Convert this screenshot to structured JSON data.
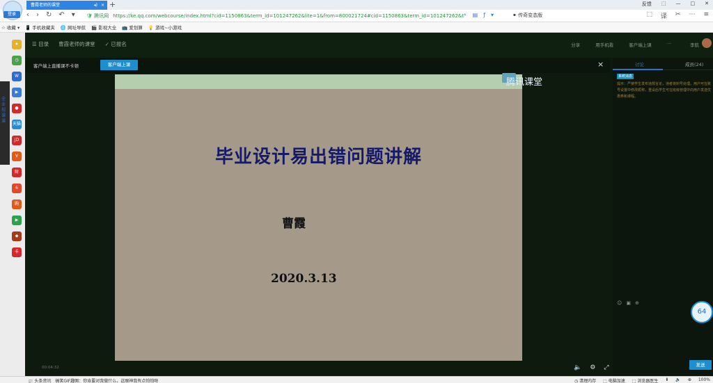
{
  "browser": {
    "login_label": "登录",
    "tab_title": "曹霞老师的课堂",
    "tab_sound_glyph": "◂)",
    "tab_close_glyph": "×",
    "new_tab_glyph": "+",
    "window_controls": [
      "反馈",
      "⬚",
      "—",
      "□",
      "✕"
    ]
  },
  "address_bar": {
    "nav": [
      "‹",
      "›",
      "↻",
      "↶",
      "▾"
    ],
    "secure_label": "🛡 腾讯网",
    "url": "https://ke.qq.com/webcourse/index.html?cid=1150863&term_id=101247262&lite=1&from=800021724#cid=1150863&term_id=101247262&t",
    "url_icons": [
      "⚡",
      "▤",
      "ƒ",
      "▾"
    ],
    "compat_mode": "⚫ 传奇变态版",
    "right_icons": [
      "⬚",
      "译",
      "✂",
      "⋯",
      "≡"
    ]
  },
  "bookmarks": [
    "☆ 收藏 ▾",
    "📱 手机收藏夹",
    "🌐 网址导航",
    "🎬 影视大全",
    "📺 爱划算",
    "💡 游戏~小游戏"
  ],
  "sidebar": {
    "vertical_label": "全业视课课",
    "icons": [
      {
        "name": "star",
        "label": "★",
        "color": "#e5b02a"
      },
      {
        "name": "clock",
        "label": "◷",
        "color": "#4aa14a"
      },
      {
        "name": "word",
        "label": "W",
        "color": "#2f6bd3"
      },
      {
        "name": "video",
        "label": "▶",
        "color": "#3a7bd5"
      },
      {
        "name": "record",
        "label": "●",
        "color": "#d22a2a"
      },
      {
        "name": "tmall",
        "label": "天猫",
        "color": "#2a8ad3"
      },
      {
        "name": "jd",
        "label": "JD",
        "color": "#d22a2a"
      },
      {
        "name": "vip",
        "label": "V",
        "color": "#e05a1a"
      },
      {
        "name": "finance",
        "label": "财",
        "color": "#d22a2a"
      },
      {
        "name": "weibo",
        "label": "6",
        "color": "#e04a2a"
      },
      {
        "name": "shopping",
        "label": "购",
        "color": "#e05a1a"
      },
      {
        "name": "play",
        "label": "▶",
        "color": "#2aa34a"
      },
      {
        "name": "game",
        "label": "◆",
        "color": "#a53a1a"
      },
      {
        "name": "card",
        "label": "卡",
        "color": "#d22a2a"
      }
    ]
  },
  "course": {
    "breadcrumb": [
      "☰ 目录",
      "曹霞老师的课堂",
      "✓ 已报名"
    ],
    "top_links": [
      "分享",
      "用手机看",
      "客户端上课",
      "···"
    ],
    "user_name": "李航",
    "notice_text": "客户端上直播课不卡顿",
    "notice_button": "客户端上课",
    "notice_close": "×"
  },
  "slide": {
    "logo_text": "腾讯课堂",
    "title": "毕业设计易出错问题讲解",
    "author": "曹霞",
    "date": "2020.3.13"
  },
  "chat": {
    "tab_discuss": "讨论",
    "tab_members": "成员(24)",
    "system_badge": "系统消息",
    "system_message": "提示：严禁学生发布违规言论，违者将封号处理。用户可在账号设置中修改昵称，重设后学生可在班级管理中向用户发送优惠券和课程。",
    "tools": [
      "☺",
      "▣",
      "⊕"
    ],
    "send_button": "发送",
    "speed_value": "64"
  },
  "video": {
    "time": "00:04:32",
    "controls": [
      "🔈",
      "⚙",
      "⤢"
    ]
  },
  "status_bar": {
    "left": [
      "📰 头条资讯",
      "搞笑GIF趣图：你肯要对我做什么，这眼神我有点怕怕呀"
    ],
    "right": [
      "◷ 清理内存",
      "⬚ 电脑加速",
      "⬚ 浏览器医生",
      "⬇",
      "🔈",
      "⊕",
      "100%"
    ]
  }
}
